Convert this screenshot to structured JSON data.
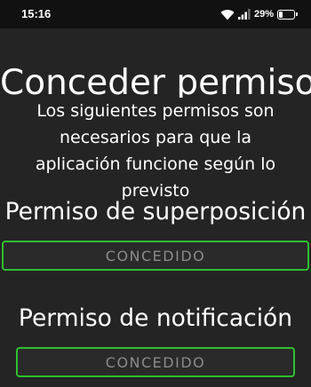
{
  "status_bar": {
    "time": "15:16",
    "battery_percent_label": "29%",
    "battery_level": 0.29,
    "icons": [
      "wifi-icon",
      "signal-icon",
      "battery-icon"
    ]
  },
  "page": {
    "title": "Conceder permiso",
    "subtitle": "Los siguientes permisos son necesarios para que la aplicación funcione según lo previsto"
  },
  "permissions": [
    {
      "heading": "Permiso de superposición",
      "button_label": "CONCEDIDO"
    },
    {
      "heading": "Permiso de notificación",
      "button_label": "CONCEDIDO"
    }
  ],
  "colors": {
    "background": "#242424",
    "status_bar": "#111111",
    "accent_border": "#2fbf2f",
    "button_text": "#8b8b8b"
  }
}
